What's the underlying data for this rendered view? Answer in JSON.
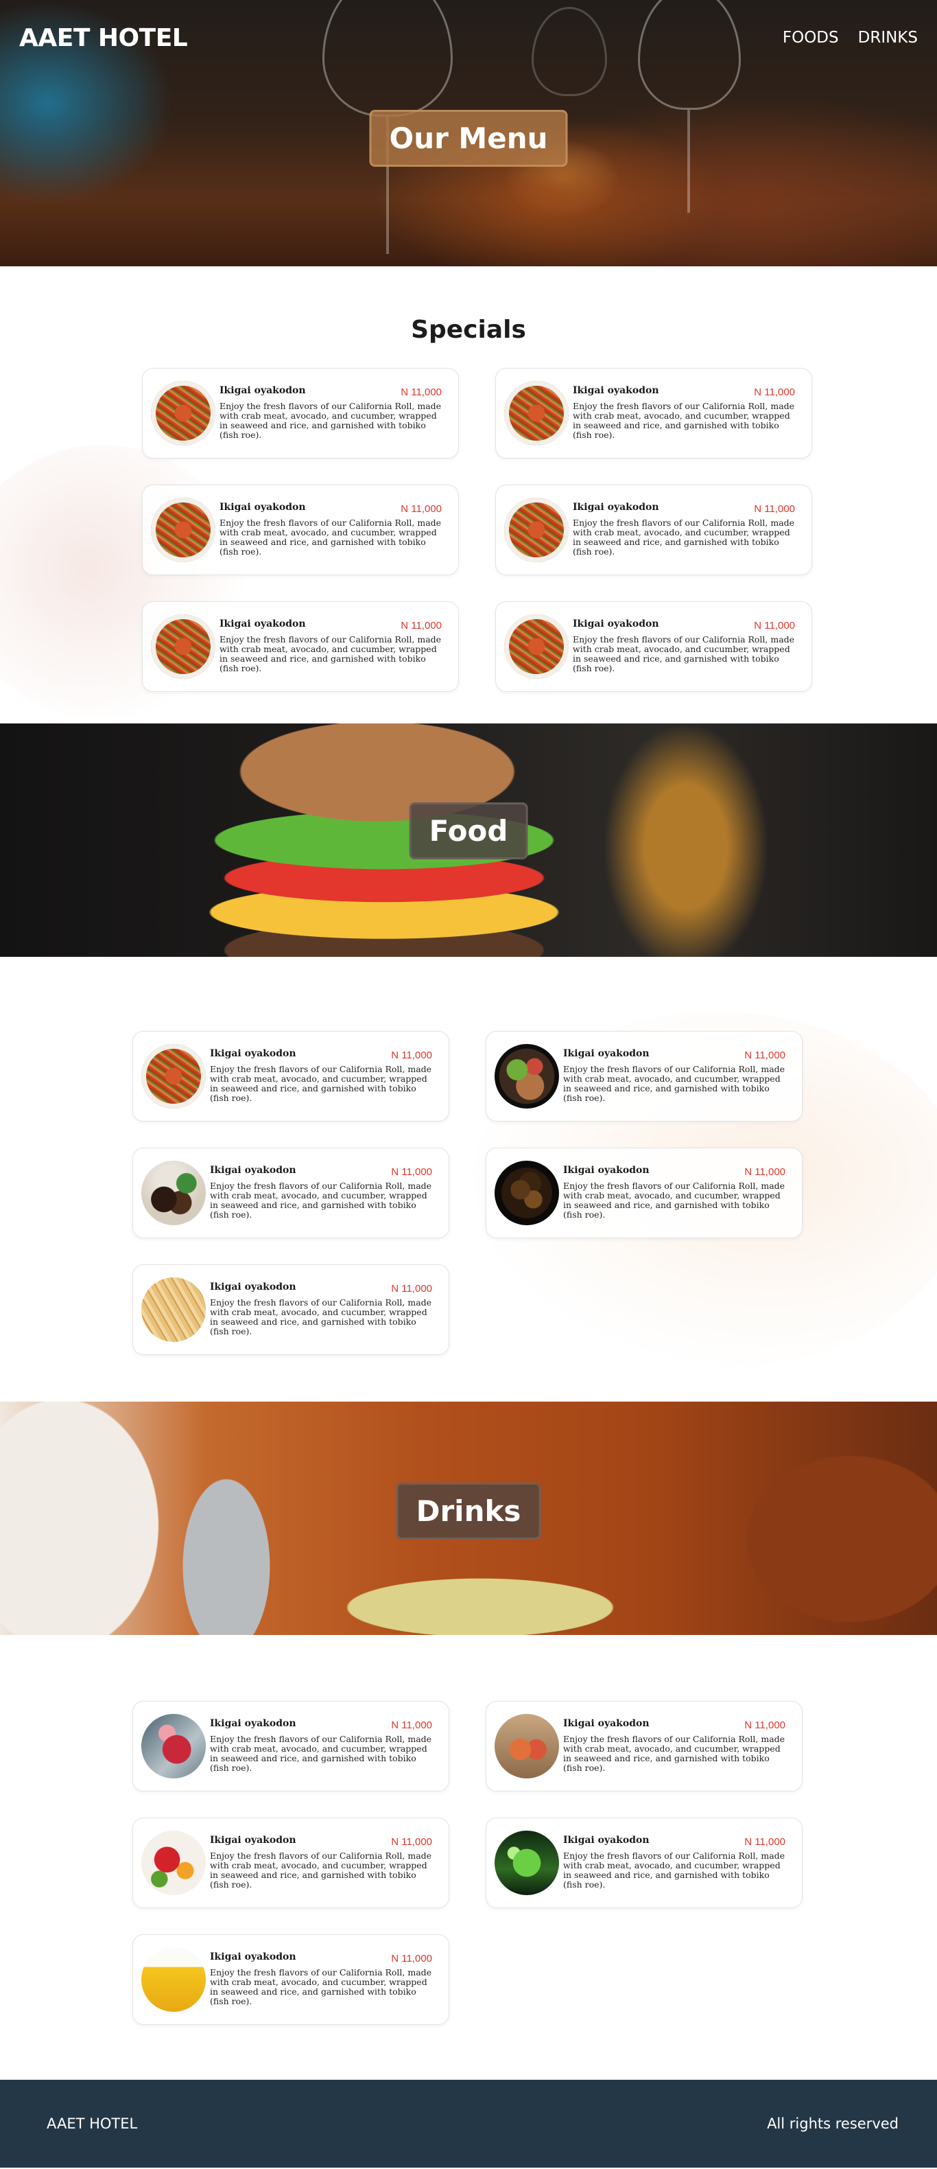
{
  "header": {
    "brand": "AAET HOTEL",
    "nav": [
      {
        "label": "FOODS"
      },
      {
        "label": "DRINKS"
      }
    ],
    "hero_title": "Our Menu"
  },
  "specials": {
    "heading": "Specials",
    "items": [
      {
        "name": "Ikigai oyakodon",
        "price": "N 11,000",
        "description": "Enjoy the fresh flavors of our California Roll, made with crab meat, avocado, and cucumber, wrapped in seaweed and rice, and garnished with tobiko (fish roe).",
        "image": "noodle-dish"
      },
      {
        "name": "Ikigai oyakodon",
        "price": "N 11,000",
        "description": "Enjoy the fresh flavors of our California Roll, made with crab meat, avocado, and cucumber, wrapped in seaweed and rice, and garnished with tobiko (fish roe).",
        "image": "noodle-dish"
      },
      {
        "name": "Ikigai oyakodon",
        "price": "N 11,000",
        "description": "Enjoy the fresh flavors of our California Roll, made with crab meat, avocado, and cucumber, wrapped in seaweed and rice, and garnished with tobiko (fish roe).",
        "image": "noodle-dish"
      },
      {
        "name": "Ikigai oyakodon",
        "price": "N 11,000",
        "description": "Enjoy the fresh flavors of our California Roll, made with crab meat, avocado, and cucumber, wrapped in seaweed and rice, and garnished with tobiko (fish roe).",
        "image": "noodle-dish"
      },
      {
        "name": "Ikigai oyakodon",
        "price": "N 11,000",
        "description": "Enjoy the fresh flavors of our California Roll, made with crab meat, avocado, and cucumber, wrapped in seaweed and rice, and garnished with tobiko (fish roe).",
        "image": "noodle-dish"
      },
      {
        "name": "Ikigai oyakodon",
        "price": "N 11,000",
        "description": "Enjoy the fresh flavors of our California Roll, made with crab meat, avocado, and cucumber, wrapped in seaweed and rice, and garnished with tobiko (fish roe).",
        "image": "noodle-dish"
      }
    ]
  },
  "food": {
    "banner_title": "Food",
    "items": [
      {
        "name": "Ikigai oyakodon",
        "price": "N 11,000",
        "description": "Enjoy the fresh flavors of our California Roll, made with crab meat, avocado, and cucumber, wrapped in seaweed and rice, and garnished with tobiko (fish roe).",
        "image": "noodle-dish"
      },
      {
        "name": "Ikigai oyakodon",
        "price": "N 11,000",
        "description": "Enjoy the fresh flavors of our California Roll, made with crab meat, avocado, and cucumber, wrapped in seaweed and rice, and garnished with tobiko (fish roe).",
        "image": "salad-dish"
      },
      {
        "name": "Ikigai oyakodon",
        "price": "N 11,000",
        "description": "Enjoy the fresh flavors of our California Roll, made with crab meat, avocado, and cucumber, wrapped in seaweed and rice, and garnished with tobiko (fish roe).",
        "image": "meat-dish"
      },
      {
        "name": "Ikigai oyakodon",
        "price": "N 11,000",
        "description": "Enjoy the fresh flavors of our California Roll, made with crab meat, avocado, and cucumber, wrapped in seaweed and rice, and garnished with tobiko (fish roe).",
        "image": "beef-dish"
      },
      {
        "name": "Ikigai oyakodon",
        "price": "N 11,000",
        "description": "Enjoy the fresh flavors of our California Roll, made with crab meat, avocado, and cucumber, wrapped in seaweed and rice, and garnished with tobiko (fish roe).",
        "image": "pasta-dish"
      }
    ]
  },
  "drinks": {
    "banner_title": "Drinks",
    "items": [
      {
        "name": "Ikigai oyakodon",
        "price": "N 11,000",
        "description": "Enjoy the fresh flavors of our California Roll, made with crab meat, avocado, and cucumber, wrapped in seaweed and rice, and garnished with tobiko (fish roe).",
        "image": "red-drink"
      },
      {
        "name": "Ikigai oyakodon",
        "price": "N 11,000",
        "description": "Enjoy the fresh flavors of our California Roll, made with crab meat, avocado, and cucumber, wrapped in seaweed and rice, and garnished with tobiko (fish roe).",
        "image": "orange-drink"
      },
      {
        "name": "Ikigai oyakodon",
        "price": "N 11,000",
        "description": "Enjoy the fresh flavors of our California Roll, made with crab meat, avocado, and cucumber, wrapped in seaweed and rice, and garnished with tobiko (fish roe).",
        "image": "sangria-drink"
      },
      {
        "name": "Ikigai oyakodon",
        "price": "N 11,000",
        "description": "Enjoy the fresh flavors of our California Roll, made with crab meat, avocado, and cucumber, wrapped in seaweed and rice, and garnished with tobiko (fish roe).",
        "image": "green-drink"
      },
      {
        "name": "Ikigai oyakodon",
        "price": "N 11,000",
        "description": "Enjoy the fresh flavors of our California Roll, made with crab meat, avocado, and cucumber, wrapped in seaweed and rice, and garnished with tobiko (fish roe).",
        "image": "yellow-drink"
      }
    ]
  },
  "footer": {
    "brand": "AAET HOTEL",
    "rights": "All rights reserved"
  },
  "colors": {
    "price": "#e2362c",
    "footer_bg": "#243746",
    "hero_badge": "#b07844"
  }
}
